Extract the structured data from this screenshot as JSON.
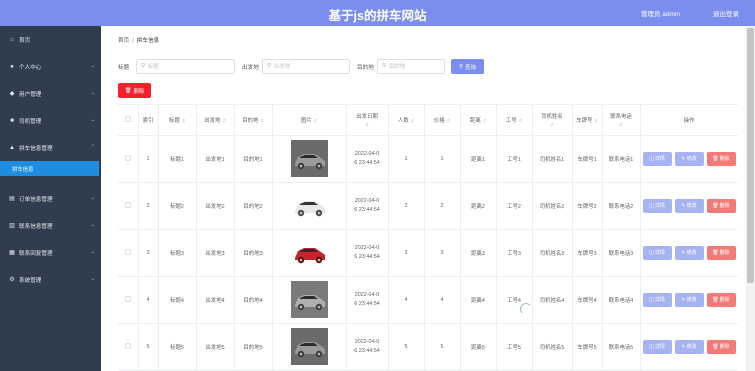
{
  "header": {
    "title": "基于js的拼车网站",
    "admin_label": "管理员 admin",
    "logout_label": "退出登录"
  },
  "sidebar": {
    "items": [
      {
        "label": "首页",
        "icon": "home-icon",
        "chevron": false
      },
      {
        "label": "个人中心",
        "icon": "user-icon",
        "chevron": true
      },
      {
        "label": "用户管理",
        "icon": "users-icon",
        "chevron": true
      },
      {
        "label": "司机管理",
        "icon": "driver-icon",
        "chevron": true
      },
      {
        "label": "拼车信息管理",
        "icon": "car-icon",
        "chevron": true,
        "expanded": true,
        "children": [
          {
            "label": "拼车信息",
            "active": true
          }
        ]
      },
      {
        "label": "订单信息管理",
        "icon": "order-icon",
        "chevron": true
      },
      {
        "label": "联系信息管理",
        "icon": "contact-icon",
        "chevron": true
      },
      {
        "label": "联系回复管理",
        "icon": "reply-icon",
        "chevron": true
      },
      {
        "label": "系统管理",
        "icon": "settings-icon",
        "chevron": true
      }
    ]
  },
  "breadcrumb": {
    "home": "首页",
    "sep": "/",
    "current": "拼车信息"
  },
  "search": {
    "title_label": "标题",
    "title_placeholder": "标题",
    "origin_label": "出发地",
    "origin_placeholder": "出发地",
    "dest_label": "目的地",
    "dest_placeholder": "目的地",
    "search_button": "查询"
  },
  "delete_button": "删除",
  "table": {
    "columns": [
      "",
      "索引",
      "标题",
      "出发地",
      "目的地",
      "图片",
      "出发日期",
      "人数",
      "价格",
      "距离",
      "工号",
      "司机姓名",
      "车牌号",
      "联系电话",
      "操作"
    ],
    "rows": [
      {
        "index": "1",
        "title": "标题1",
        "origin": "出发地1",
        "dest": "目的地1",
        "image": "car-gray-suv",
        "date_line1": "2022-04-0",
        "date_line2": "6 23:44:54",
        "people": "1",
        "price": "1",
        "distance": "距离1",
        "job_no": "工号1",
        "driver": "司机姓名1",
        "plate": "车牌号1",
        "phone": "联系电话1"
      },
      {
        "index": "2",
        "title": "标题2",
        "origin": "出发地2",
        "dest": "目的地2",
        "image": "car-white-suv",
        "date_line1": "2022-04-0",
        "date_line2": "6 23:44:54",
        "people": "2",
        "price": "2",
        "distance": "距离2",
        "job_no": "工号2",
        "driver": "司机姓名2",
        "plate": "车牌号2",
        "phone": "联系电话2"
      },
      {
        "index": "3",
        "title": "标题3",
        "origin": "出发地3",
        "dest": "目的地3",
        "image": "car-red-sedan",
        "date_line1": "2022-04-0",
        "date_line2": "6 23:44:54",
        "people": "3",
        "price": "3",
        "distance": "距离3",
        "job_no": "工号3",
        "driver": "司机姓名3",
        "plate": "车牌号3",
        "phone": "联系电话3"
      },
      {
        "index": "4",
        "title": "标题4",
        "origin": "出发地4",
        "dest": "目的地4",
        "image": "car-gray-hatch",
        "date_line1": "2022-04-0",
        "date_line2": "6 23:44:54",
        "people": "4",
        "price": "4",
        "distance": "距离4",
        "job_no": "工号4",
        "driver": "司机姓名4",
        "plate": "车牌号4",
        "phone": "联系电话4"
      },
      {
        "index": "5",
        "title": "标题5",
        "origin": "出发地5",
        "dest": "目的地5",
        "image": "car-gray-suv",
        "date_line1": "2022-04-0",
        "date_line2": "6 23:44:54",
        "people": "5",
        "price": "5",
        "distance": "距离5",
        "job_no": "工号5",
        "driver": "司机姓名5",
        "plate": "车牌号5",
        "phone": "联系电话5"
      }
    ],
    "actions": {
      "detail": "详情",
      "edit": "修改",
      "delete": "删除"
    }
  },
  "colors": {
    "header_bg": "#7b8ef0",
    "sidebar_bg": "#2f3d4e",
    "sidebar_active": "#1f8ce0",
    "primary": "#7b8ef0",
    "danger": "#f5222d",
    "action_delete": "#f37a76"
  }
}
